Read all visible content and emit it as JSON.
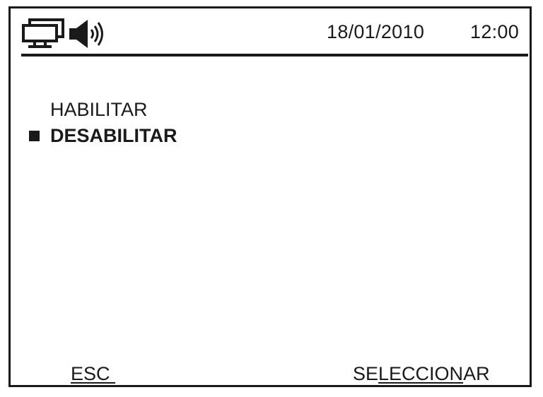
{
  "status_bar": {
    "icons": [
      "network-icon",
      "speaker-icon"
    ],
    "date": "18/01/2010",
    "time": "12:00"
  },
  "menu": {
    "items": [
      {
        "label": "HABILITAR",
        "selected": false
      },
      {
        "label": "DESABILITAR",
        "selected": true
      }
    ]
  },
  "soft_keys": {
    "left": "ESC",
    "right_prefix": "SE",
    "right_underlined": "LECCION",
    "right_suffix": "AR"
  },
  "colors": {
    "ink": "#1a1a1a",
    "background": "#ffffff"
  }
}
